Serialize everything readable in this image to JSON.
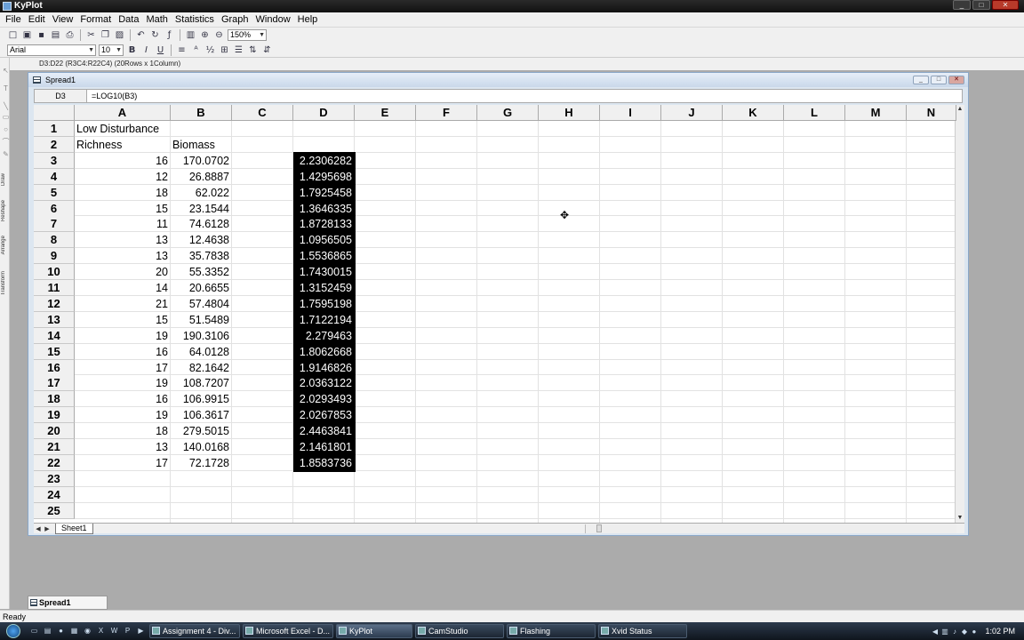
{
  "app": {
    "title": "KyPlot",
    "status": "Ready"
  },
  "menu": [
    "File",
    "Edit",
    "View",
    "Format",
    "Data",
    "Math",
    "Statistics",
    "Graph",
    "Window",
    "Help"
  ],
  "toolbar": {
    "icons": [
      "new-icon",
      "open-icon",
      "save-icon",
      "print-preview-icon",
      "print-icon",
      "cut-icon",
      "copy-icon",
      "paste-icon",
      "undo-icon",
      "redo-icon",
      "insert-function-icon",
      "graph-icon",
      "zoom-in-icon",
      "zoom-out-icon"
    ],
    "zoom": "150%",
    "font": "Arial",
    "font_size": "10",
    "bold_label": "B",
    "italic_label": "I",
    "underline_label": "U"
  },
  "refbar": "D3:D22   (R3C4:R22C4) (20Rows x 1Column)",
  "left_toolbar": [
    "Draw",
    "Reshape",
    "Arrange",
    "Transform"
  ],
  "spreadsheet": {
    "title": "Spread1",
    "cell_ref": "D3",
    "formula": "=LOG10(B3)",
    "columns": [
      "A",
      "B",
      "C",
      "D",
      "E",
      "F",
      "G",
      "H",
      "I",
      "J",
      "K",
      "L",
      "M",
      "N"
    ],
    "rows": [
      "1",
      "2",
      "3",
      "4",
      "5",
      "6",
      "7",
      "8",
      "9",
      "10",
      "11",
      "12",
      "13",
      "14",
      "15",
      "16",
      "17",
      "18",
      "19",
      "20",
      "21",
      "22",
      "23",
      "24",
      "25"
    ],
    "a1": "Low Disturbance",
    "a2": "Richness",
    "b2": "Biomass",
    "richness": [
      "16",
      "12",
      "18",
      "15",
      "11",
      "13",
      "13",
      "20",
      "14",
      "21",
      "15",
      "19",
      "16",
      "17",
      "19",
      "16",
      "19",
      "18",
      "13",
      "17"
    ],
    "biomass": [
      "170.0702",
      "26.8887",
      "62.022",
      "23.1544",
      "74.6128",
      "12.4638",
      "35.7838",
      "55.3352",
      "20.6655",
      "57.4804",
      "51.5489",
      "190.3106",
      "64.0128",
      "82.1642",
      "108.7207",
      "106.9915",
      "106.3617",
      "279.5015",
      "140.0168",
      "72.1728"
    ],
    "log_biomass": [
      "2.2306282",
      "1.4295698",
      "1.7925458",
      "1.3646335",
      "1.8728133",
      "1.0956505",
      "1.5536865",
      "1.7430015",
      "1.3152459",
      "1.7595198",
      "1.7122194",
      "2.279463",
      "1.8062668",
      "1.9146826",
      "2.0363122",
      "2.0293493",
      "2.0267853",
      "2.4463841",
      "2.1461801",
      "1.8583736"
    ],
    "sheet_tab": "Sheet1"
  },
  "minimized_window": "Spread1",
  "taskbar": {
    "tasks": [
      {
        "label": "Assignment 4 - Div...",
        "active": false
      },
      {
        "label": "Microsoft Excel - D...",
        "active": false
      },
      {
        "label": "KyPlot",
        "active": true
      },
      {
        "label": "CamStudio",
        "active": false
      },
      {
        "label": "Flashing",
        "active": false
      },
      {
        "label": "Xvid Status",
        "active": false
      }
    ],
    "clock": "1:02 PM"
  },
  "colors": {
    "selection": "#000000",
    "title_bar": "#1a1a1a",
    "mdi_background": "#ababab"
  }
}
